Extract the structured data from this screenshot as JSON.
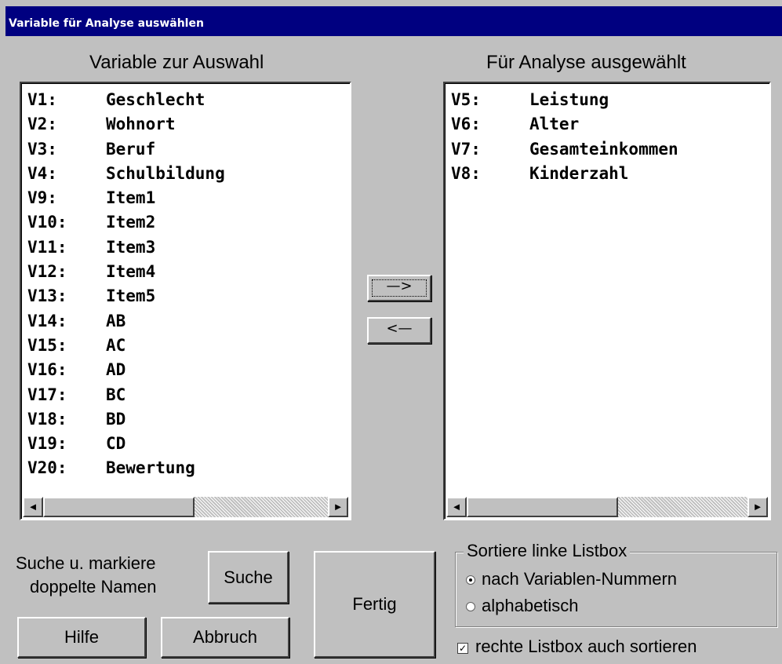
{
  "window": {
    "title": "Variable für Analyse auswählen"
  },
  "left_list": {
    "heading": "Variable zur Auswahl",
    "items": [
      {
        "code": "V1:",
        "name": "Geschlecht"
      },
      {
        "code": "V2:",
        "name": "Wohnort"
      },
      {
        "code": "V3:",
        "name": "Beruf"
      },
      {
        "code": "V4:",
        "name": "Schulbildung"
      },
      {
        "code": "V9:",
        "name": "Item1"
      },
      {
        "code": "V10:",
        "name": "Item2"
      },
      {
        "code": "V11:",
        "name": "Item3"
      },
      {
        "code": "V12:",
        "name": "Item4"
      },
      {
        "code": "V13:",
        "name": "Item5"
      },
      {
        "code": "V14:",
        "name": "AB"
      },
      {
        "code": "V15:",
        "name": "AC"
      },
      {
        "code": "V16:",
        "name": "AD"
      },
      {
        "code": "V17:",
        "name": "BC"
      },
      {
        "code": "V18:",
        "name": "BD"
      },
      {
        "code": "V19:",
        "name": "CD"
      },
      {
        "code": "V20:",
        "name": "Bewertung"
      }
    ]
  },
  "right_list": {
    "heading": "Für Analyse ausgewählt",
    "items": [
      {
        "code": "V5:",
        "name": "Leistung"
      },
      {
        "code": "V6:",
        "name": "Alter"
      },
      {
        "code": "V7:",
        "name": "Gesamteinkommen"
      },
      {
        "code": "V8:",
        "name": "Kinderzahl"
      }
    ]
  },
  "transfer": {
    "add_label": "—>",
    "remove_label": "<—"
  },
  "scroll": {
    "left_glyph": "◄",
    "right_glyph": "►"
  },
  "search": {
    "label_line1": "Suche u. markiere",
    "label_line2": "doppelte Namen",
    "button": "Suche"
  },
  "buttons": {
    "help": "Hilfe",
    "cancel": "Abbruch",
    "done": "Fertig"
  },
  "sort": {
    "group_title": "Sortiere linke Listbox",
    "option_number": "nach Variablen-Nummern",
    "option_alpha": "alphabetisch",
    "selected": "number",
    "also_right_label": "rechte Listbox auch sortieren",
    "also_right_checked": true,
    "check_glyph": "✓"
  }
}
